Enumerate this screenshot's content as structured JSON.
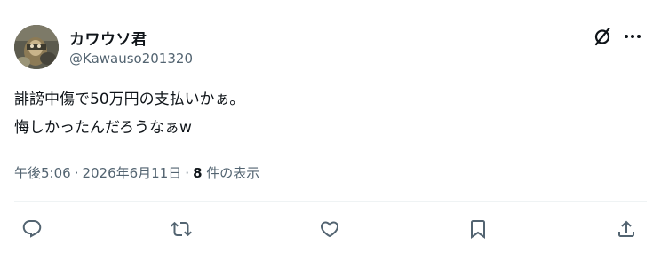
{
  "user": {
    "display_name": "カワウソ君",
    "handle": "@Kawauso201320"
  },
  "tweet": {
    "lines": [
      "誹謗中傷で50万円の支払いかぁ。",
      "悔しかったんだろうなぁw"
    ]
  },
  "meta": {
    "time": "午後5:06",
    "separator": "·",
    "date": "2026年6月11日",
    "views_count": "8",
    "views_label": "件の表示"
  },
  "icons": {
    "header": [
      "grok-icon",
      "more-icon"
    ],
    "actions": [
      "reply-icon",
      "retweet-icon",
      "like-icon",
      "bookmark-icon",
      "share-icon"
    ]
  },
  "colors": {
    "text_primary": "#0f1419",
    "text_secondary": "#536471",
    "divider": "#eff3f4"
  }
}
